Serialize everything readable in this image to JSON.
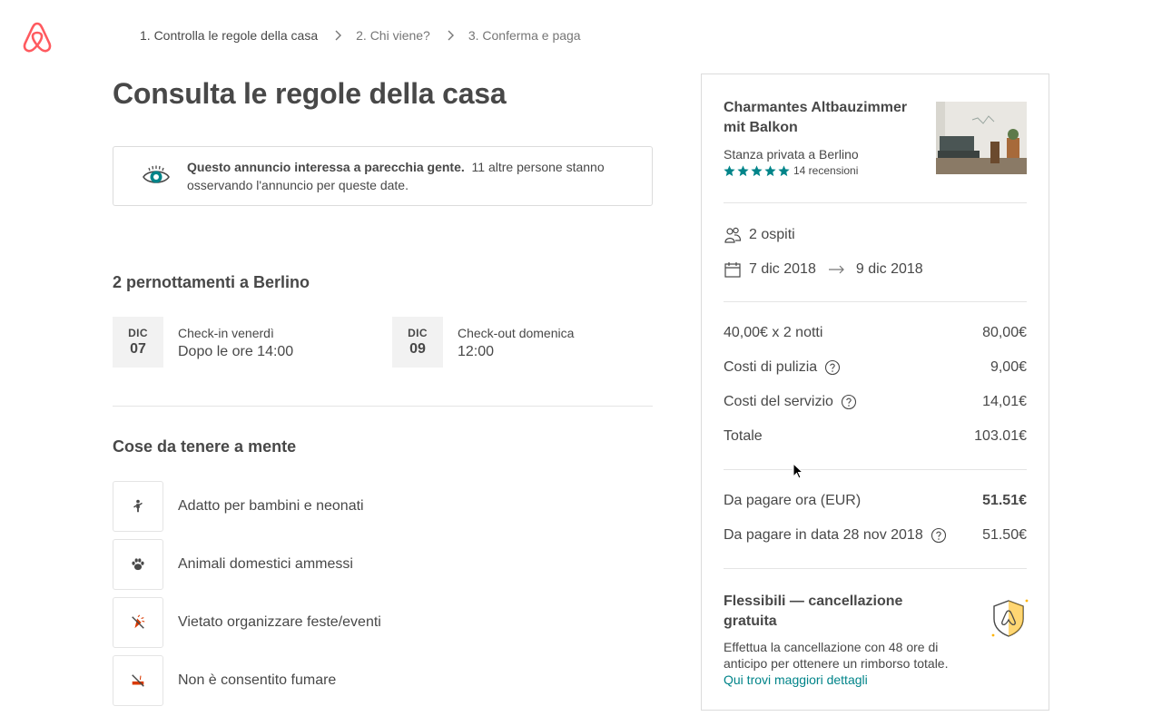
{
  "colors": {
    "brand": "#FF5A5F",
    "teal": "#008489",
    "text": "#484848",
    "muted": "#767676",
    "red_icon": "#D93900"
  },
  "breadcrumb": {
    "steps": [
      {
        "label": "1. Controlla le regole della casa"
      },
      {
        "label": "2. Chi viene?"
      },
      {
        "label": "3. Conferma e paga"
      }
    ]
  },
  "page_title": "Consulta le regole della casa",
  "notice": {
    "icon": "eye-icon",
    "bold": "Questo annuncio interessa a parecchia gente.",
    "text": "11 altre persone stanno osservando l'annuncio per queste date."
  },
  "stay": {
    "heading": "2 pernottamenti a Berlino",
    "checkin": {
      "month": "DIC",
      "day": "07",
      "label": "Check-in venerdì",
      "time": "Dopo le ore 14:00"
    },
    "checkout": {
      "month": "DIC",
      "day": "09",
      "label": "Check-out domenica",
      "time": "12:00"
    }
  },
  "rules": {
    "heading": "Cose da tenere a mente",
    "items": [
      {
        "label": "Adatto per bambini e neonati",
        "icon": "child-icon"
      },
      {
        "label": "Animali domestici ammessi",
        "icon": "paw-icon"
      },
      {
        "label": "Vietato organizzare feste/eventi",
        "icon": "no-party-icon"
      },
      {
        "label": "Non è consentito fumare",
        "icon": "no-smoking-icon"
      }
    ]
  },
  "listing": {
    "title": "Charmantes Altbauzimmer mit Balkon",
    "subtitle": "Stanza privata a Berlino",
    "rating_stars": 5,
    "reviews": "14 recensioni"
  },
  "booking": {
    "guests": "2 ospiti",
    "checkin_date": "7 dic 2018",
    "checkout_date": "9 dic 2018"
  },
  "prices": [
    {
      "label": "40,00€ x 2 notti",
      "value": "80,00€",
      "help": false
    },
    {
      "label": "Costi di pulizia",
      "value": "9,00€",
      "help": true
    },
    {
      "label": "Costi del servizio",
      "value": "14,01€",
      "help": true
    },
    {
      "label": "Totale",
      "value": "103.01€",
      "help": false
    }
  ],
  "payment": {
    "now_label": "Da pagare ora (EUR)",
    "now_value": "51.51€",
    "later_label": "Da pagare in data 28 nov 2018",
    "later_value": "51.50€"
  },
  "policy": {
    "title": "Flessibili — cancellazione gratuita",
    "text": "Effettua la cancellazione con 48 ore di anticipo per ottenere un rimborso totale.",
    "link": "Qui trovi maggiori dettagli"
  }
}
